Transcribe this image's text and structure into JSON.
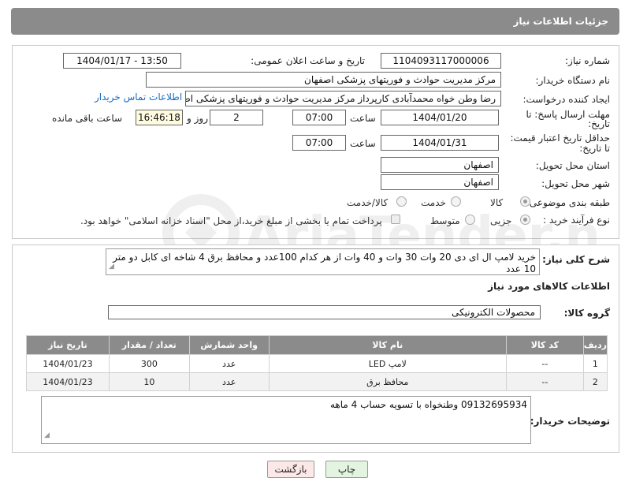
{
  "header": {
    "title": "جزئیات اطلاعات نیاز"
  },
  "form": {
    "need_number_label": "شماره نیاز:",
    "need_number": "1104093117000006",
    "announce_label": "تاریخ و ساعت اعلان عمومی:",
    "announce_value": "1404/01/17 - 13:50",
    "buyer_org_label": "نام دستگاه خریدار:",
    "buyer_org": "مرکز مدیریت حوادث و فوریتهای پزشکی اصفهان",
    "requester_label": "ایجاد کننده درخواست:",
    "requester": "رضا وطن خواه محمدآبادی کارپرداز مرکز مدیریت حوادث و فوریتهای پزشکی اصفهان",
    "contact_link": "اطلاعات تماس خریدار",
    "reply_deadline_label_1": "مهلت ارسال پاسخ: تا",
    "reply_deadline_label_2": "تاریخ:",
    "reply_date": "1404/01/20",
    "time_label": "ساعت",
    "reply_time": "07:00",
    "days_value": "2",
    "days_label": "روز و",
    "remaining_time": "16:46:18",
    "remaining_label": "ساعت باقی مانده",
    "validity_label_1": "حداقل تاریخ اعتبار قیمت:",
    "validity_label_2": "تا تاریخ:",
    "validity_date": "1404/01/31",
    "validity_time": "07:00",
    "province_label": "استان محل تحویل:",
    "province": "اصفهان",
    "city_label": "شهر محل تحویل:",
    "city": "اصفهان",
    "category_label": "طبقه بندی موضوعی:",
    "category_options": [
      "کالا",
      "خدمت",
      "کالا/خدمت"
    ],
    "category_selected": "کالا",
    "process_label": "نوع فرآیند خرید :",
    "process_options": [
      "جزیی",
      "متوسط"
    ],
    "process_selected": "جزیی",
    "treasury_note": "پرداخت تمام یا بخشی از مبلغ خرید،از محل \"اسناد خزانه اسلامی\" خواهد بود."
  },
  "details": {
    "description_label": "شرح کلی نیاز:",
    "description": "خرید لامپ ال ای دی 20 وات 30 وات و 40 وات از هر کدام 100عدد و محافظ برق 4 شاخه ای کابل دو متر 10 عدد",
    "goods_info_title": "اطلاعات کالاهای مورد نیاز",
    "goods_group_label": "گروه کالا:",
    "goods_group": "محصولات الکترونیکی",
    "table": {
      "headers": [
        "ردیف",
        "کد کالا",
        "نام کالا",
        "واحد شمارش",
        "تعداد / مقدار",
        "تاریخ نیاز"
      ],
      "rows": [
        [
          "1",
          "--",
          "لامپ LED",
          "عدد",
          "300",
          "1404/01/23"
        ],
        [
          "2",
          "--",
          "محافظ برق",
          "عدد",
          "10",
          "1404/01/23"
        ]
      ]
    },
    "buyer_notes_label": "توضیحات خریدار:",
    "buyer_notes": "09132695934 وطنخواه با تسویه حساب 4 ماهه"
  },
  "buttons": {
    "print": "چاپ",
    "back": "بازگشت"
  },
  "watermark": {
    "text": "AriaTender.neT"
  },
  "colors": {
    "header_bg": "#8b8b8b",
    "link": "#1a6cc4",
    "back_button_bg": "#fde8e8",
    "print_button_bg": "#e3f5e0",
    "remaining_bg": "#fffbe0"
  }
}
